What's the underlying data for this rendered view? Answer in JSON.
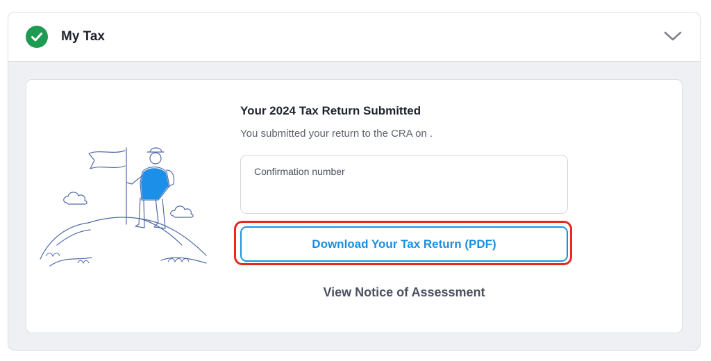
{
  "header": {
    "title": "My Tax",
    "status_icon": "check-circle-icon",
    "status_color": "#1e9a52",
    "toggle_icon": "chevron-down-icon"
  },
  "card": {
    "heading": "Your 2024 Tax Return Submitted",
    "subtext": "You submitted your return to the CRA on .",
    "confirmation_label": "Confirmation number",
    "download_button": "Download Your Tax Return (PDF)",
    "notice_link": "View Notice of Assessment",
    "accent_color": "#1a92e0",
    "highlight_color": "#e8281e",
    "illustration": "hiker-with-flag-illustration"
  }
}
